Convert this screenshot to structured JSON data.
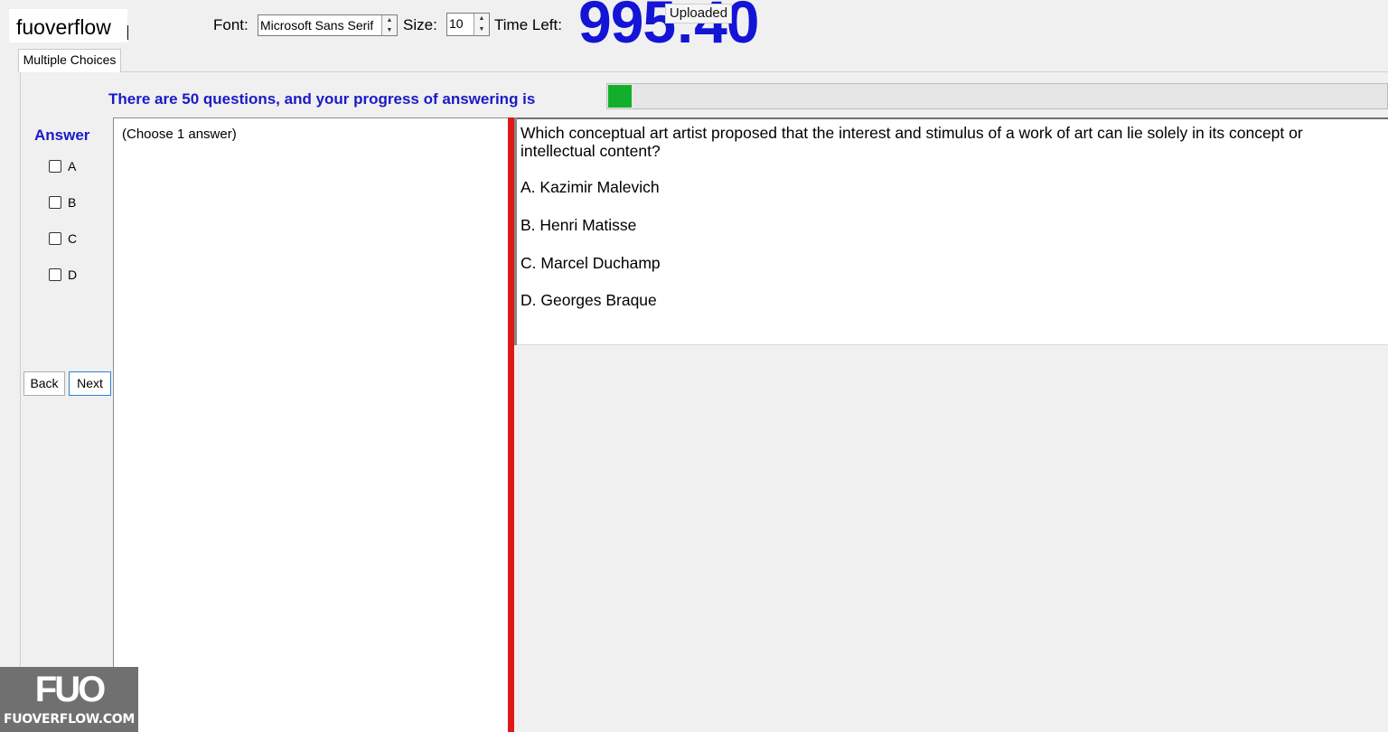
{
  "watermark": {
    "text": "fuoverflow",
    "logo_mark": "FUO",
    "site": "FUOVERFLOW.COM"
  },
  "toolbar": {
    "font_label": "Font:",
    "font_value": "Microsoft Sans Serif",
    "size_label": "Size:",
    "size_value": "10",
    "time_left_label": "Time Left:",
    "timer_value": "995:40",
    "uploaded_label": "Uploaded"
  },
  "tab": {
    "label": "Multiple Choices"
  },
  "progress": {
    "label": "There are 50 questions, and your progress of answering is",
    "fraction": 0.03,
    "color": "#12b02a"
  },
  "answer": {
    "title": "Answer",
    "options": [
      "A",
      "B",
      "C",
      "D"
    ]
  },
  "nav": {
    "back_label": "Back",
    "next_label": "Next"
  },
  "answer_panel": {
    "instruction": "(Choose 1 answer)"
  },
  "question": {
    "text": "Which conceptual art artist proposed that the interest and stimulus of a work of art can lie solely in its concept or intellectual content?",
    "choices": [
      "A.  Kazimir Malevich",
      "B.  Henri Matisse",
      "C.  Marcel Duchamp",
      "D.  Georges Braque"
    ]
  },
  "colors": {
    "accent": "#1a1ac8",
    "timer": "#1414d6",
    "splitter": "#e01818"
  }
}
